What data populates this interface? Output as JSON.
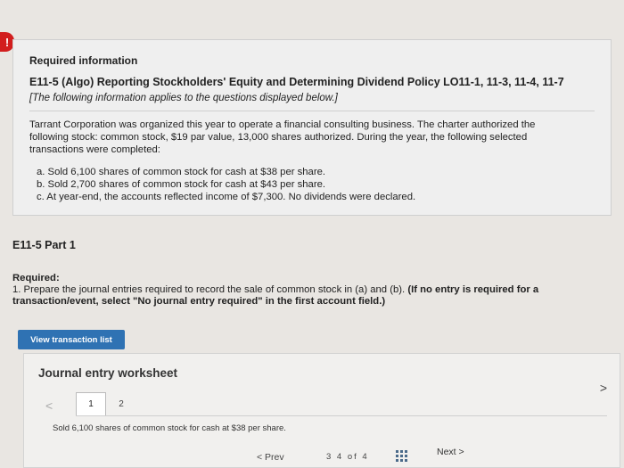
{
  "alert": {
    "glyph": "!"
  },
  "info": {
    "heading": "Required information",
    "exercise_title": "E11-5 (Algo) Reporting Stockholders' Equity and Determining Dividend Policy LO11-1, 11-3, 11-4, 11-7",
    "note": "[The following information applies to the questions displayed below.]",
    "intro": "Tarrant Corporation was organized this year to operate a financial consulting business. The charter authorized the following stock: common stock, $19 par value, 13,000 shares authorized. During the year, the following selected transactions were completed:",
    "transactions": [
      "a. Sold 6,100 shares of common stock for cash at $38 per share.",
      "b. Sold 2,700 shares of common stock for cash at $43 per share.",
      "c. At year-end, the accounts reflected income of $7,300. No dividends were declared."
    ]
  },
  "part": {
    "title": "E11-5 Part 1",
    "required_label": "Required:",
    "required_text": "1. Prepare the journal entries required to record the sale of common stock in (a) and (b).",
    "required_bold": "(If no entry is required for a transaction/event, select \"No journal entry required\" in the first account field.)"
  },
  "buttons": {
    "view_transactions": "View transaction list"
  },
  "worksheet": {
    "title": "Journal entry worksheet",
    "prev_arrow": "<",
    "next_arrow": ">",
    "tabs": [
      "1",
      "2"
    ],
    "description": "Sold 6,100 shares of common stock for cash at $38 per share."
  },
  "nav": {
    "prev": "< Prev",
    "pages": "3  4  of 4",
    "next": "Next >"
  }
}
